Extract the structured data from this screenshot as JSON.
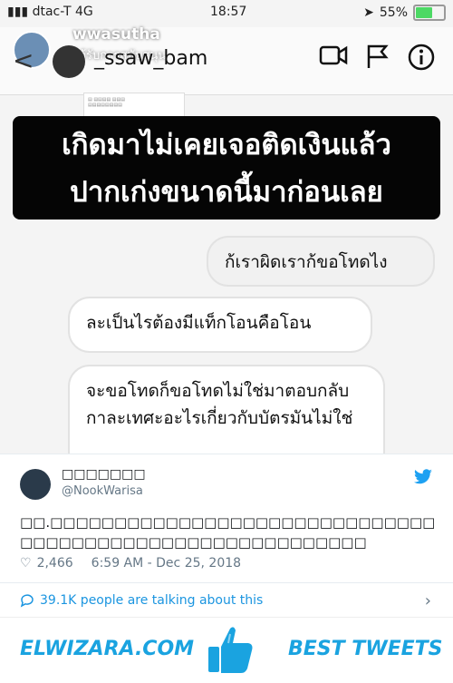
{
  "status_bar": {
    "carrier": "dtac-T",
    "network": "4G",
    "time": "18:57",
    "battery": "55%",
    "battery_level": 0.55
  },
  "chat_header": {
    "username": "_ssaw_bam",
    "overlay_username": "wwasutha",
    "overlay_subtitle": "ได้รับการสนับสนุน"
  },
  "caption": {
    "line1": "เกิดมาไม่เคยเจอติดเงินแล้ว",
    "line2": "ปากเก่งขนาดนี้มาก่อนเลย"
  },
  "messages": [
    {
      "text": "ก้เราผิดเราก้ขอโทดไง",
      "side": "right"
    },
    {
      "text": "ละเป็นไรต้องมีแท็กโอนคือโอน",
      "side": "left"
    },
    {
      "text": "จะขอโทดก็ขอโทดไม่ใช่มาตอบกลับกาละเทศะอะไรเกี่ยวกับบัตรมันไม่ใช่",
      "side": "left"
    }
  ],
  "tweet": {
    "display_name": "□□□□□□□",
    "handle": "@NookWarisa",
    "text": "□□.□□□□□□□□□□□□□□□□□□□□□□□□□□□□□□□□□□□□□□□□□□□□□□□□□□□□□□□□□",
    "likes": "2,466",
    "timestamp": "6:59 AM - Dec 25, 2018",
    "talking": "39.1K people are talking about this"
  },
  "footer": {
    "left": "ELWIZARA.COM",
    "right": "BEST TWEETS"
  },
  "colors": {
    "twitter_blue": "#1da1f2",
    "brand_blue": "#1aa3e0"
  }
}
